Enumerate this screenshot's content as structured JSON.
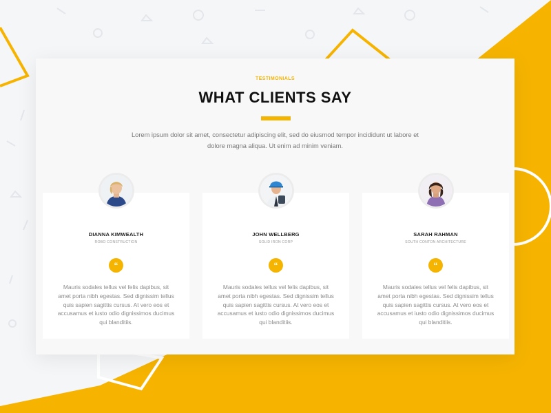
{
  "section": {
    "eyebrow": "TESTIMONIALS",
    "title": "WHAT CLIENTS SAY",
    "intro": "Lorem ipsum dolor sit amet, consectetur adipiscing elit, sed do eiusmod tempor incididunt ut labore et dolore magna aliqua. Ut enim ad minim veniam."
  },
  "testimonials": [
    {
      "name": "DIANNA KIMWEALTH",
      "company": "ROBO CONSTRUCTION",
      "quote_icon": "quote-icon",
      "text": "Mauris sodales tellus vel felis dapibus, sit amet porta nibh egestas. Sed dignissim tellus quis sapien sagittis cursus. At vero eos et accusamus et iusto odio dignissimos ducimus qui blanditiis."
    },
    {
      "name": "JOHN WELLBERG",
      "company": "SOLID IRON CORP",
      "quote_icon": "quote-icon",
      "text": "Mauris sodales tellus vel felis dapibus, sit amet porta nibh egestas. Sed dignissim tellus quis sapien sagittis cursus. At vero eos et accusamus et iusto odio dignissimos ducimus qui blanditiis."
    },
    {
      "name": "SARAH RAHMAN",
      "company": "SOUTH CONTON ARCHITECTURE",
      "quote_icon": "quote-icon",
      "text": "Mauris sodales tellus vel felis dapibus, sit amet porta nibh egestas. Sed dignissim tellus quis sapien sagittis cursus. At vero eos et accusamus et iusto odio dignissimos ducimus qui blanditiis."
    }
  ],
  "colors": {
    "accent": "#f5b400",
    "background": "#f5f6f8",
    "card": "#ffffff"
  }
}
